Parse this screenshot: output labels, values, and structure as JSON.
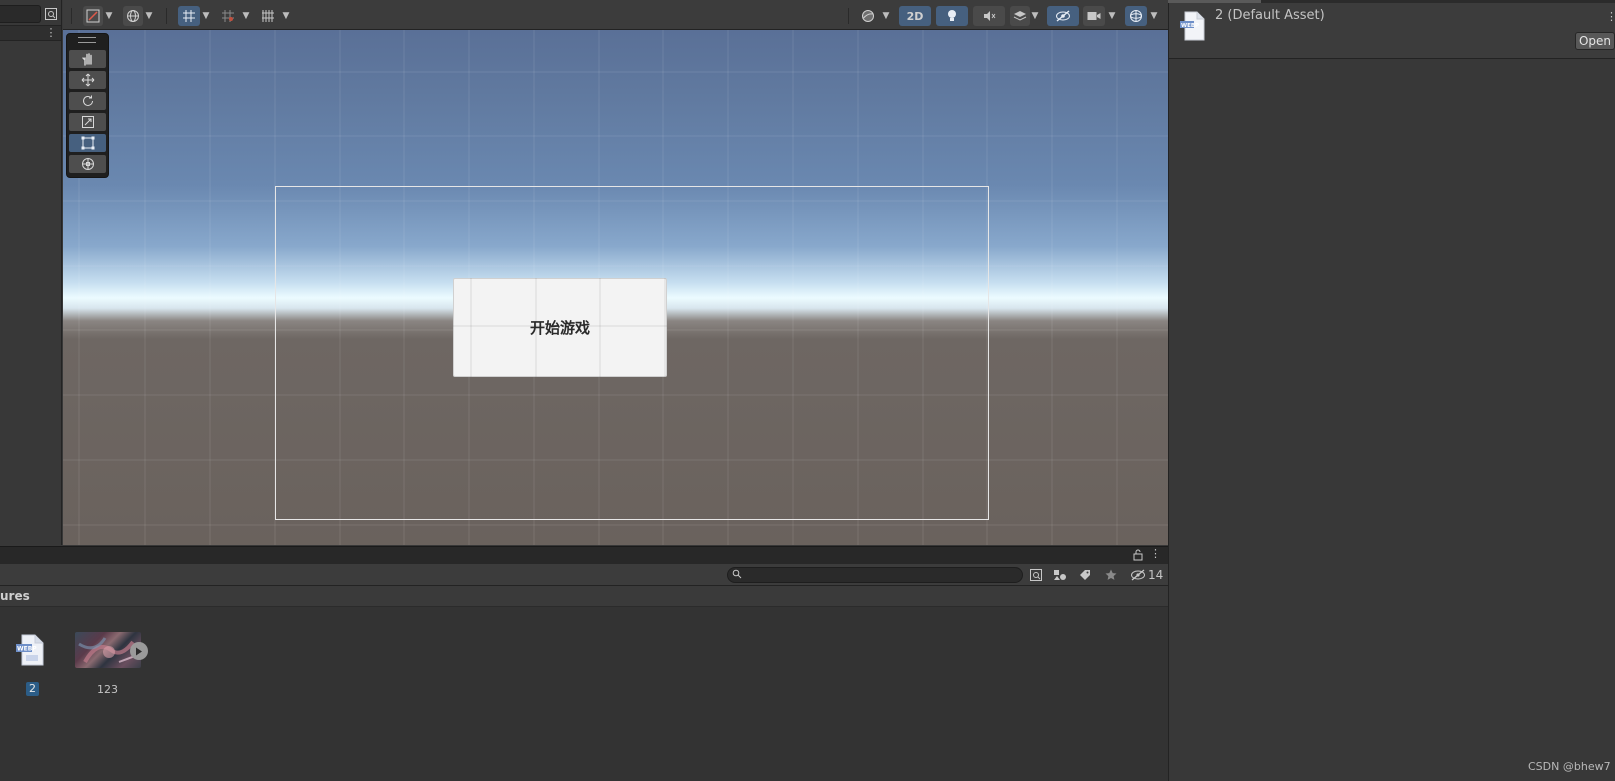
{
  "scene": {
    "ui_button_text": "开始游戏",
    "toolbar": {
      "mode_2d_label": "2D"
    }
  },
  "inspector": {
    "title": "2 (Default Asset)",
    "open_label": "Open",
    "menu_icon": "more-vertical-icon"
  },
  "project": {
    "breadcrumb": "ures",
    "hidden_count": "14",
    "assets": [
      {
        "label": "2",
        "icon": "webp-file-icon",
        "selected": true
      },
      {
        "label": "123",
        "icon": "video-thumbnail",
        "selected": false
      }
    ]
  },
  "watermark": "CSDN @bhew7",
  "colors": {
    "accent": "#46607f",
    "selection": "#2c5d87",
    "panel": "#383838"
  }
}
